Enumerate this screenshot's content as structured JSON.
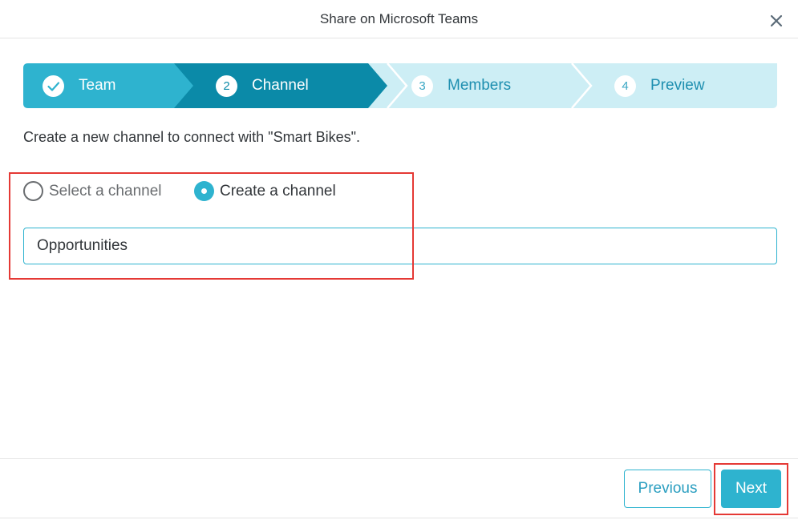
{
  "dialog": {
    "title": "Share on Microsoft Teams",
    "close_icon": "close-icon"
  },
  "wizard": {
    "steps": [
      {
        "number": "",
        "label": "Team",
        "state": "completed",
        "icon": "check-icon"
      },
      {
        "number": "2",
        "label": "Channel",
        "state": "active"
      },
      {
        "number": "3",
        "label": "Members",
        "state": "upcoming"
      },
      {
        "number": "4",
        "label": "Preview",
        "state": "upcoming"
      }
    ],
    "colors": {
      "completed": "#2eb3cf",
      "active": "#0b8aa8",
      "upcoming": "#cdeef5"
    }
  },
  "description": "Create a new channel to connect with \"Smart Bikes\".",
  "channel_mode": {
    "options": [
      {
        "label": "Select a channel",
        "selected": false
      },
      {
        "label": "Create a channel",
        "selected": true
      }
    ]
  },
  "channel_input": {
    "value": "Opportunities"
  },
  "footer": {
    "previous_label": "Previous",
    "next_label": "Next"
  },
  "colors": {
    "accent": "#2eb3cf",
    "highlight": "#e53935"
  }
}
